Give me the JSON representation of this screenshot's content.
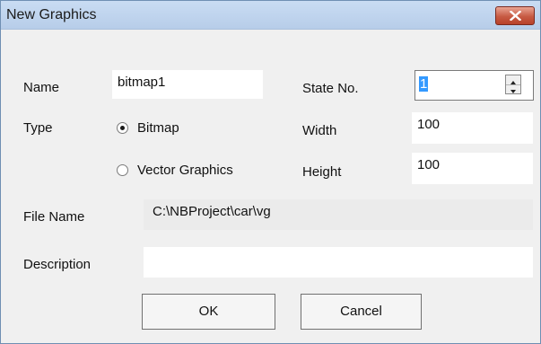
{
  "window": {
    "title": "New Graphics"
  },
  "fields": {
    "name": {
      "label": "Name",
      "value": "bitmap1"
    },
    "state_no": {
      "label": "State No.",
      "value": "1"
    },
    "type": {
      "label": "Type",
      "options": [
        {
          "label": "Bitmap",
          "selected": true
        },
        {
          "label": "Vector Graphics",
          "selected": false
        }
      ]
    },
    "width": {
      "label": "Width",
      "value": "100"
    },
    "height": {
      "label": "Height",
      "value": "100"
    },
    "file_name": {
      "label": "File Name",
      "value": "C:\\NBProject\\car\\vg"
    },
    "description": {
      "label": "Description",
      "value": ""
    }
  },
  "buttons": {
    "ok": "OK",
    "cancel": "Cancel"
  },
  "icons": {
    "close": "close-icon",
    "spin_up": "triangle-up-icon",
    "spin_down": "triangle-down-icon"
  },
  "colors": {
    "title_bar": "#c9dcf3",
    "close_button": "#c75a43",
    "selection": "#3399ff",
    "window_bg": "#f0f0f0"
  }
}
